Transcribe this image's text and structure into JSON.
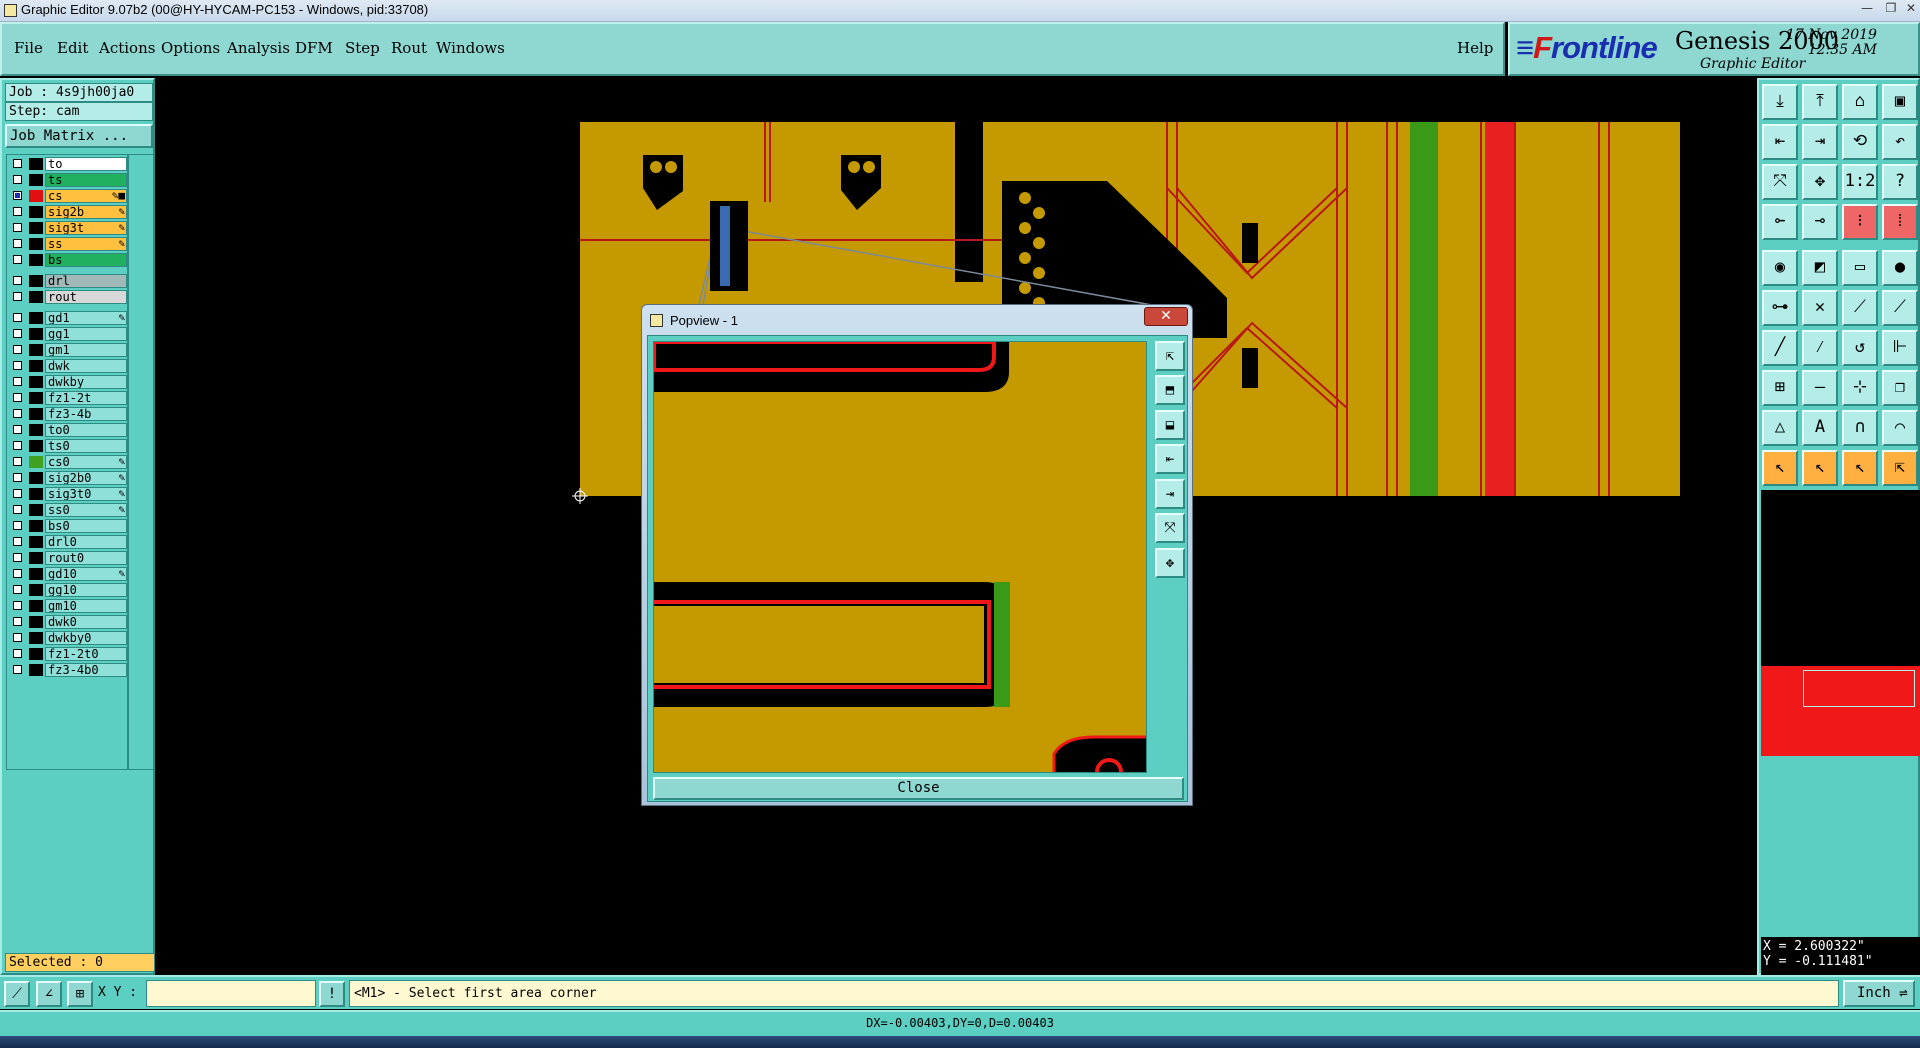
{
  "window": {
    "title": "Graphic Editor 9.07b2 (00@HY-HYCAM-PC153 - Windows, pid:33708)"
  },
  "menu": [
    "File",
    "Edit",
    "Actions",
    "Options",
    "Analysis",
    "DFM",
    "Step",
    "Rout",
    "Windows"
  ],
  "help_label": "Help",
  "logo": {
    "brand_front": "F",
    "brand_rest": "rontline",
    "product": "Genesis 2000",
    "subtitle": "Graphic Editor",
    "date": "17 Nov 2019",
    "time": "12:35 AM"
  },
  "job": {
    "job_label": "Job : 4s9jh00ja0",
    "step_label": "Step: cam",
    "matrix_button": "Job Matrix ..."
  },
  "layers": [
    {
      "name": "to",
      "color": "#ffffff",
      "swatch": "#000000",
      "edit": "",
      "selected": false
    },
    {
      "name": "ts",
      "color": "#20b060",
      "swatch": "#000000",
      "edit": "",
      "selected": false
    },
    {
      "name": "cs",
      "color": "#ffc040",
      "swatch": "#e01010",
      "edit": "✎■",
      "selected": true
    },
    {
      "name": "sig2b",
      "color": "#ffc040",
      "swatch": "#000000",
      "edit": "✎",
      "selected": false
    },
    {
      "name": "sig3t",
      "color": "#ffc040",
      "swatch": "#000000",
      "edit": "✎",
      "selected": false
    },
    {
      "name": "ss",
      "color": "#ffc040",
      "swatch": "#000000",
      "edit": "✎",
      "selected": false
    },
    {
      "name": "bs",
      "color": "#20b060",
      "swatch": "#000000",
      "edit": "",
      "selected": false
    },
    {
      "name": "drl",
      "color": "#a0b8b8",
      "swatch": "#000000",
      "edit": "",
      "selected": false
    },
    {
      "name": "rout",
      "color": "#d8d8d8",
      "swatch": "#000000",
      "edit": "",
      "selected": false
    },
    {
      "name": "gd1",
      "color": "#8fe0d8",
      "swatch": "#000000",
      "edit": "✎",
      "selected": false
    },
    {
      "name": "gg1",
      "color": "#8fe0d8",
      "swatch": "#000000",
      "edit": "",
      "selected": false
    },
    {
      "name": "gm1",
      "color": "#8fe0d8",
      "swatch": "#000000",
      "edit": "",
      "selected": false
    },
    {
      "name": "dwk",
      "color": "#8fe0d8",
      "swatch": "#000000",
      "edit": "",
      "selected": false
    },
    {
      "name": "dwkby",
      "color": "#8fe0d8",
      "swatch": "#000000",
      "edit": "",
      "selected": false
    },
    {
      "name": "fz1-2t",
      "color": "#8fe0d8",
      "swatch": "#000000",
      "edit": "",
      "selected": false
    },
    {
      "name": "fz3-4b",
      "color": "#8fe0d8",
      "swatch": "#000000",
      "edit": "",
      "selected": false
    },
    {
      "name": "to0",
      "color": "#8fe0d8",
      "swatch": "#000000",
      "edit": "",
      "selected": false
    },
    {
      "name": "ts0",
      "color": "#8fe0d8",
      "swatch": "#000000",
      "edit": "",
      "selected": false
    },
    {
      "name": "cs0",
      "color": "#8fe0d8",
      "swatch": "#40a020",
      "edit": "✎",
      "selected": false
    },
    {
      "name": "sig2b0",
      "color": "#8fe0d8",
      "swatch": "#000000",
      "edit": "✎",
      "selected": false
    },
    {
      "name": "sig3t0",
      "color": "#8fe0d8",
      "swatch": "#000000",
      "edit": "✎",
      "selected": false
    },
    {
      "name": "ss0",
      "color": "#8fe0d8",
      "swatch": "#000000",
      "edit": "✎",
      "selected": false
    },
    {
      "name": "bs0",
      "color": "#8fe0d8",
      "swatch": "#000000",
      "edit": "",
      "selected": false
    },
    {
      "name": "drl0",
      "color": "#8fe0d8",
      "swatch": "#000000",
      "edit": "",
      "selected": false
    },
    {
      "name": "rout0",
      "color": "#8fe0d8",
      "swatch": "#000000",
      "edit": "",
      "selected": false
    },
    {
      "name": "gd10",
      "color": "#8fe0d8",
      "swatch": "#000000",
      "edit": "✎",
      "selected": false
    },
    {
      "name": "gg10",
      "color": "#8fe0d8",
      "swatch": "#000000",
      "edit": "",
      "selected": false
    },
    {
      "name": "gm10",
      "color": "#8fe0d8",
      "swatch": "#000000",
      "edit": "",
      "selected": false
    },
    {
      "name": "dwk0",
      "color": "#8fe0d8",
      "swatch": "#000000",
      "edit": "",
      "selected": false
    },
    {
      "name": "dwkby0",
      "color": "#8fe0d8",
      "swatch": "#000000",
      "edit": "",
      "selected": false
    },
    {
      "name": "fz1-2t0",
      "color": "#8fe0d8",
      "swatch": "#000000",
      "edit": "",
      "selected": false
    },
    {
      "name": "fz3-4b0",
      "color": "#8fe0d8",
      "swatch": "#000000",
      "edit": "",
      "selected": false
    }
  ],
  "selected_label": "Selected : 0",
  "tools": [
    {
      "name": "step-in-icon",
      "glyph": "⤓",
      "style": ""
    },
    {
      "name": "step-out-icon",
      "glyph": "⤒",
      "style": ""
    },
    {
      "name": "home-icon",
      "glyph": "⌂",
      "style": ""
    },
    {
      "name": "panel-icon",
      "glyph": "▣",
      "style": ""
    },
    {
      "name": "pan-left-icon",
      "glyph": "⇤",
      "style": ""
    },
    {
      "name": "pan-right-icon",
      "glyph": "⇥",
      "style": ""
    },
    {
      "name": "redraw-icon",
      "glyph": "⟲",
      "style": ""
    },
    {
      "name": "undo-icon",
      "glyph": "↶",
      "style": ""
    },
    {
      "name": "zoom-fit-icon",
      "glyph": "⤧",
      "style": ""
    },
    {
      "name": "zoom-area-icon",
      "glyph": "✥",
      "style": ""
    },
    {
      "name": "scale-icon",
      "glyph": "1:2",
      "style": ""
    },
    {
      "name": "query-icon",
      "glyph": "?",
      "style": ""
    },
    {
      "name": "measure-icon",
      "glyph": "⟜",
      "style": ""
    },
    {
      "name": "feature-icon",
      "glyph": "⊸",
      "style": ""
    },
    {
      "name": "snap-icon",
      "glyph": "⁝",
      "style": "red"
    },
    {
      "name": "grid-snap-icon",
      "glyph": "⁞",
      "style": "red"
    },
    {
      "name": "pad-icon",
      "glyph": "◉",
      "style": ""
    },
    {
      "name": "surface-icon",
      "glyph": "◩",
      "style": ""
    },
    {
      "name": "ruler-icon",
      "glyph": "▭",
      "style": ""
    },
    {
      "name": "circle-icon",
      "glyph": "●",
      "style": ""
    },
    {
      "name": "node-icon",
      "glyph": "⊶",
      "style": ""
    },
    {
      "name": "delete-node-icon",
      "glyph": "✕",
      "style": ""
    },
    {
      "name": "connect-icon",
      "glyph": "⟋",
      "style": ""
    },
    {
      "name": "link-icon",
      "glyph": "⟋",
      "style": ""
    },
    {
      "name": "line-icon",
      "glyph": "╱",
      "style": ""
    },
    {
      "name": "slash-icon",
      "glyph": "⁄",
      "style": ""
    },
    {
      "name": "arc-icon",
      "glyph": "↺",
      "style": ""
    },
    {
      "name": "route-icon",
      "glyph": "⊩",
      "style": ""
    },
    {
      "name": "move-icon",
      "glyph": "⊞",
      "style": ""
    },
    {
      "name": "split-icon",
      "glyph": "—",
      "style": ""
    },
    {
      "name": "center-icon",
      "glyph": "⊹",
      "style": ""
    },
    {
      "name": "copy-icon",
      "glyph": "❐",
      "style": ""
    },
    {
      "name": "triangle-icon",
      "glyph": "△",
      "style": ""
    },
    {
      "name": "a-shape-icon",
      "glyph": "Α",
      "style": ""
    },
    {
      "name": "arch-icon",
      "glyph": "∩",
      "style": ""
    },
    {
      "name": "bridge-icon",
      "glyph": "⌒",
      "style": ""
    },
    {
      "name": "pointer-icon",
      "glyph": "↖",
      "style": "org"
    },
    {
      "name": "select-icon",
      "glyph": "↖",
      "style": "org"
    },
    {
      "name": "pick-icon",
      "glyph": "↖",
      "style": "org"
    },
    {
      "name": "multi-select-icon",
      "glyph": "⇱",
      "style": "org"
    }
  ],
  "coords": {
    "x": "X = 2.600322\"",
    "y": "Y = -0.111481\""
  },
  "status": {
    "xy_label": "X Y :",
    "xy_value": "",
    "prompt": "<M1> - Select first area corner",
    "units": "Inch ⇌",
    "measure": "DX=-0.00403,DY=0,D=0.00403",
    "mode_glyph": "!"
  },
  "popup": {
    "title": "Popview - 1",
    "close_x": "✕",
    "close_button": "Close",
    "side_glyphs": [
      "⇱",
      "⬒",
      "⬓",
      "⇤",
      "⇥",
      "⤧",
      "✥"
    ]
  }
}
